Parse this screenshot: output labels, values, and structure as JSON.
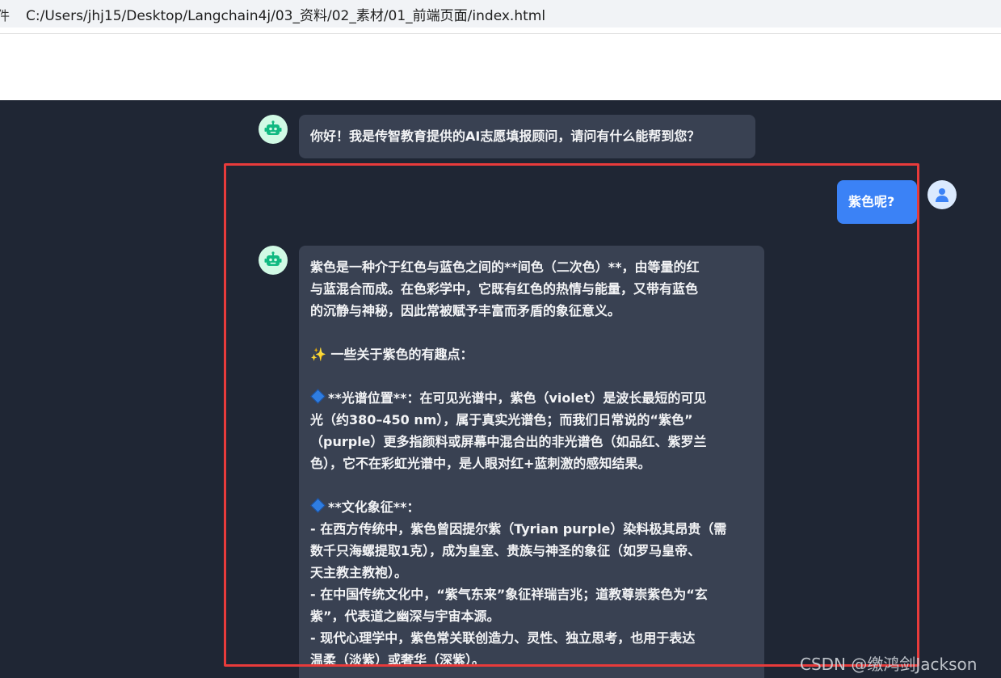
{
  "browser": {
    "tab_prefix": "件",
    "url": "C:/Users/jhj15/Desktop/Langchain4j/03_资料/02_素材/01_前端页面/index.html"
  },
  "chat": {
    "greeting": "你好！我是传智教育提供的AI志愿填报顾问，请问有什么能帮到您？",
    "user_message": "紫色呢?",
    "reply": {
      "lines": [
        "紫色是一种介于红色与蓝色之间的**间色（二次色）**，由等量的红",
        "与蓝混合而成。在色彩学中，它既有红色的热情与能量，又带有蓝色",
        "的沉静与神秘，因此常被赋予丰富而矛盾的象征意义。",
        "",
        "一些关于紫色的有趣点：",
        "",
        "**光谱位置**：在可见光谱中，紫色（violet）是波长最短的可见",
        "光（约380–450 nm），属于真实光谱色；而我们日常说的“紫色”",
        "（purple）更多指颜料或屏幕中混合出的非光谱色（如品红、紫罗兰",
        "色），它不在彩虹光谱中，是人眼对红+蓝刺激的感知结果。",
        "",
        "**文化象征**：",
        "- 在西方传统中，紫色曾因提尔紫（Tyrian purple）染料极其昂贵（需",
        "数千只海螺提取1克），成为皇室、贵族与神圣的象征（如罗马皇帝、",
        "天主教主教袍）。",
        "- 在中国传统文化中，“紫气东来”象征祥瑞吉兆；道教尊崇紫色为“玄",
        "紫”，代表道之幽深与宇宙本源。",
        "- 现代心理学中，紫色常关联创造力、灵性、独立思考，也用于表达",
        "温柔（淡紫）或奢华（深紫）。"
      ]
    }
  },
  "watermark": "CSDN @缴鸿剑Jackson",
  "colors": {
    "chat_bg": "#1f2634",
    "assistant_bubble": "#394152",
    "user_bubble": "#3b82f6",
    "highlight": "#e83b3b"
  },
  "icons": {
    "bot_avatar": "robot-icon",
    "user_avatar": "user-icon",
    "sparkle": "sparkle-icon",
    "diamond": "blue-diamond-icon"
  }
}
